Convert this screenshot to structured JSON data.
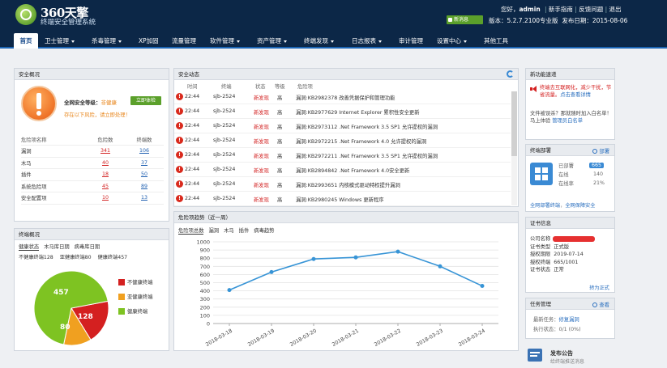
{
  "brand": {
    "name": "360天擎",
    "subtitle": "终端安全管理系统"
  },
  "header": {
    "greeting_prefix": "您好，",
    "user": "admin",
    "links": [
      "新手指南",
      "反馈问题",
      "退出"
    ],
    "messages_badge": "新消息",
    "version": "版本：5.2.7.2100专业版",
    "release_date": "发布日期：2015-08-06"
  },
  "nav": [
    {
      "label": "首页"
    },
    {
      "label": "卫士管理"
    },
    {
      "label": "杀毒管理"
    },
    {
      "label": "XP加固"
    },
    {
      "label": "流量管理"
    },
    {
      "label": "软件管理"
    },
    {
      "label": "资产管理"
    },
    {
      "label": "终端发现"
    },
    {
      "label": "日志报表"
    },
    {
      "label": "审计管理"
    },
    {
      "label": "设置中心"
    },
    {
      "label": "其他工具"
    }
  ],
  "security_overview": {
    "title": "安全概况",
    "level_label": "全网安全等级：",
    "level_value": "非健康",
    "check_button": "立即体检",
    "hint": "存在以下风险，请立即处理！",
    "columns": [
      "危险项名称",
      "危险数",
      "终端数"
    ],
    "rows": [
      [
        "漏洞",
        "341",
        "106"
      ],
      [
        "木马",
        "40",
        "37"
      ],
      [
        "插件",
        "18",
        "50"
      ],
      [
        "系统危险项",
        "45",
        "89"
      ],
      [
        "安全配置项",
        "10",
        "13"
      ]
    ]
  },
  "terminal_overview": {
    "title": "终端概况",
    "tabs": [
      "健康状态",
      "木马库日期",
      "病毒库日期"
    ],
    "stat1": "不健康终端128",
    "stat2": "亚健康终端80",
    "stat3": "健康终端457",
    "legend": [
      "不健康终端",
      "亚健康终端",
      "健康终端"
    ],
    "pie_labels": [
      "457",
      "80",
      "128"
    ],
    "colors": [
      "#d42020",
      "#f0a020",
      "#7ec322"
    ]
  },
  "pie_data": {
    "type": "pie",
    "labels": [
      "健康终端",
      "亚健康终端",
      "不健康终端"
    ],
    "values": [
      457,
      80,
      128
    ]
  },
  "security_events": {
    "title": "安全动态",
    "columns": [
      "时间",
      "终端",
      "状态",
      "等级",
      "危险项"
    ],
    "rows": [
      [
        "22:44",
        "sjb-2524",
        "新发现",
        "高",
        "漏洞:KB2982378 改善凭据保护和管理功能"
      ],
      [
        "22:44",
        "sjb-2524",
        "新发现",
        "高",
        "漏洞:KB2977629 Internet Explorer 累积性安全更新"
      ],
      [
        "22:44",
        "sjb-2524",
        "新发现",
        "高",
        "漏洞:KB2973112 .Net Framework 3.5 SP1 允许提权的漏洞"
      ],
      [
        "22:44",
        "sjb-2524",
        "新发现",
        "高",
        "漏洞:KB2972215 .Net Framework 4.0 允许提权的漏洞"
      ],
      [
        "22:44",
        "sjb-2524",
        "新发现",
        "高",
        "漏洞:KB2972211 .Net Framework 3.5 SP1 允许提权的漏洞"
      ],
      [
        "22:44",
        "sjb-2524",
        "新发现",
        "高",
        "漏洞:KB2894842 .Net Framework 4.0安全更新"
      ],
      [
        "22:44",
        "sjb-2524",
        "新发现",
        "高",
        "漏洞:KB2993651 内核模式驱动特权提升漏洞"
      ],
      [
        "22:44",
        "sjb-2524",
        "新发现",
        "高",
        "漏洞:KB2980245 Windows 更新程序"
      ]
    ]
  },
  "risk_trend": {
    "title": "危险项趋势（近一周）",
    "tabs": [
      "危险项总数",
      "漏洞",
      "木马",
      "插件",
      "病毒趋势"
    ]
  },
  "chart_data": {
    "type": "line",
    "x": [
      "2018-03-18",
      "2018-03-19",
      "2018-03-20",
      "2018-03-21",
      "2018-03-22",
      "2018-03-23",
      "2018-03-24"
    ],
    "values": [
      410,
      630,
      790,
      810,
      880,
      700,
      460
    ],
    "ylim": [
      0,
      1000
    ],
    "yticks": [
      "0",
      "100",
      "200",
      "300",
      "400",
      "500",
      "600",
      "700",
      "800",
      "900",
      "1000"
    ],
    "grid": true,
    "color": "#3794d6"
  },
  "feature_promo": {
    "title": "新功能速递",
    "headline": "终端去互联网化，减少干扰，节省流量。",
    "action": "点击查看详情",
    "text": "文件被误杀？那就随时加入白名单！马上体验",
    "link": "管理员白名单"
  },
  "deployment": {
    "title": "终端部署",
    "action": "部署",
    "rows": [
      [
        "已部署",
        "665"
      ],
      [
        "在线",
        "140"
      ],
      [
        "在线率",
        "21%"
      ]
    ],
    "link1": "全网部署终端",
    "link2": "全网保障安全"
  },
  "license": {
    "title": "证书信息",
    "rows": [
      [
        "公司名称",
        ""
      ],
      [
        "证书类型",
        "正式版"
      ],
      [
        "授权期限",
        "2019-07-14"
      ],
      [
        "授权终端",
        "665/1001"
      ],
      [
        "证书状态",
        "正常"
      ]
    ],
    "convert_link": "转为正式"
  },
  "tasks": {
    "title": "任务管理",
    "action": "查看",
    "latest_label": "最新任务：",
    "latest_value": "修复漏洞",
    "status_label": "执行状态：",
    "status_value": "0/1 (0%)"
  },
  "announcement": {
    "title": "发布公告",
    "sub": "给终端推送消息"
  }
}
